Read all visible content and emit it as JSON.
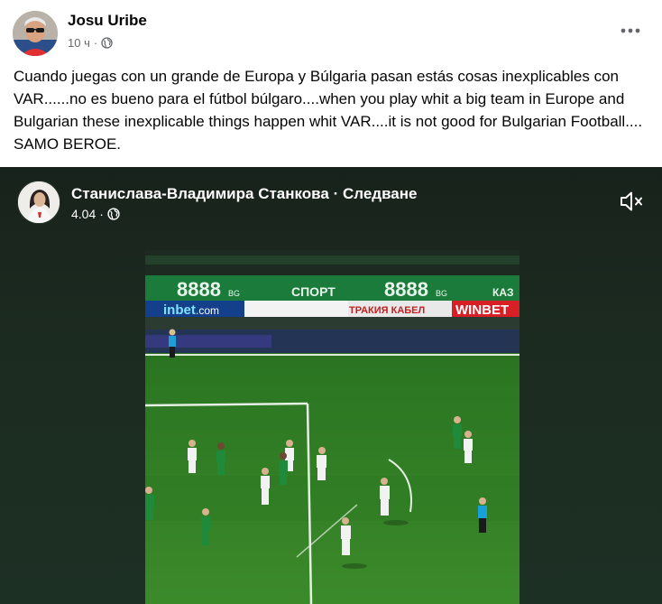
{
  "post": {
    "author": "Josu Uribe",
    "time": "10 ч",
    "separator": "·",
    "text": "Cuando juegas con un grande de Europa y Búlgaria pasan estás cosas inexplicables con VAR......no es bueno para el fútbol búlgaro....when you play whit a big team in Europe and  Bulgarian these inexplicable things happen whit VAR....it is not good for Bulgarian Football.... SAMO BEROE.",
    "more_icon": "more-horizontal-icon",
    "privacy_icon": "globe-icon"
  },
  "video": {
    "author": "Станислава-Владимира Станкова · Следване",
    "date": "4.04",
    "separator": "·",
    "privacy_icon": "globe-icon",
    "mute_icon": "speaker-muted-icon",
    "billboards": {
      "top_left": "8888",
      "top_left_sub": "BG",
      "sport": "СПОРТ",
      "top_right": "8888",
      "top_right_sub": "BG",
      "kaz": "КАЗ",
      "inbet": "inbet",
      "inbet_suffix": ".com",
      "trakia": "ТРАКИЯ КАБЕЛ",
      "winbet": "WINBET"
    },
    "colors": {
      "pitch": "#2f7a26",
      "home_kit": "#1f8a3a",
      "away_kit": "#f2f2f2",
      "referee": "#19a0d8"
    }
  }
}
